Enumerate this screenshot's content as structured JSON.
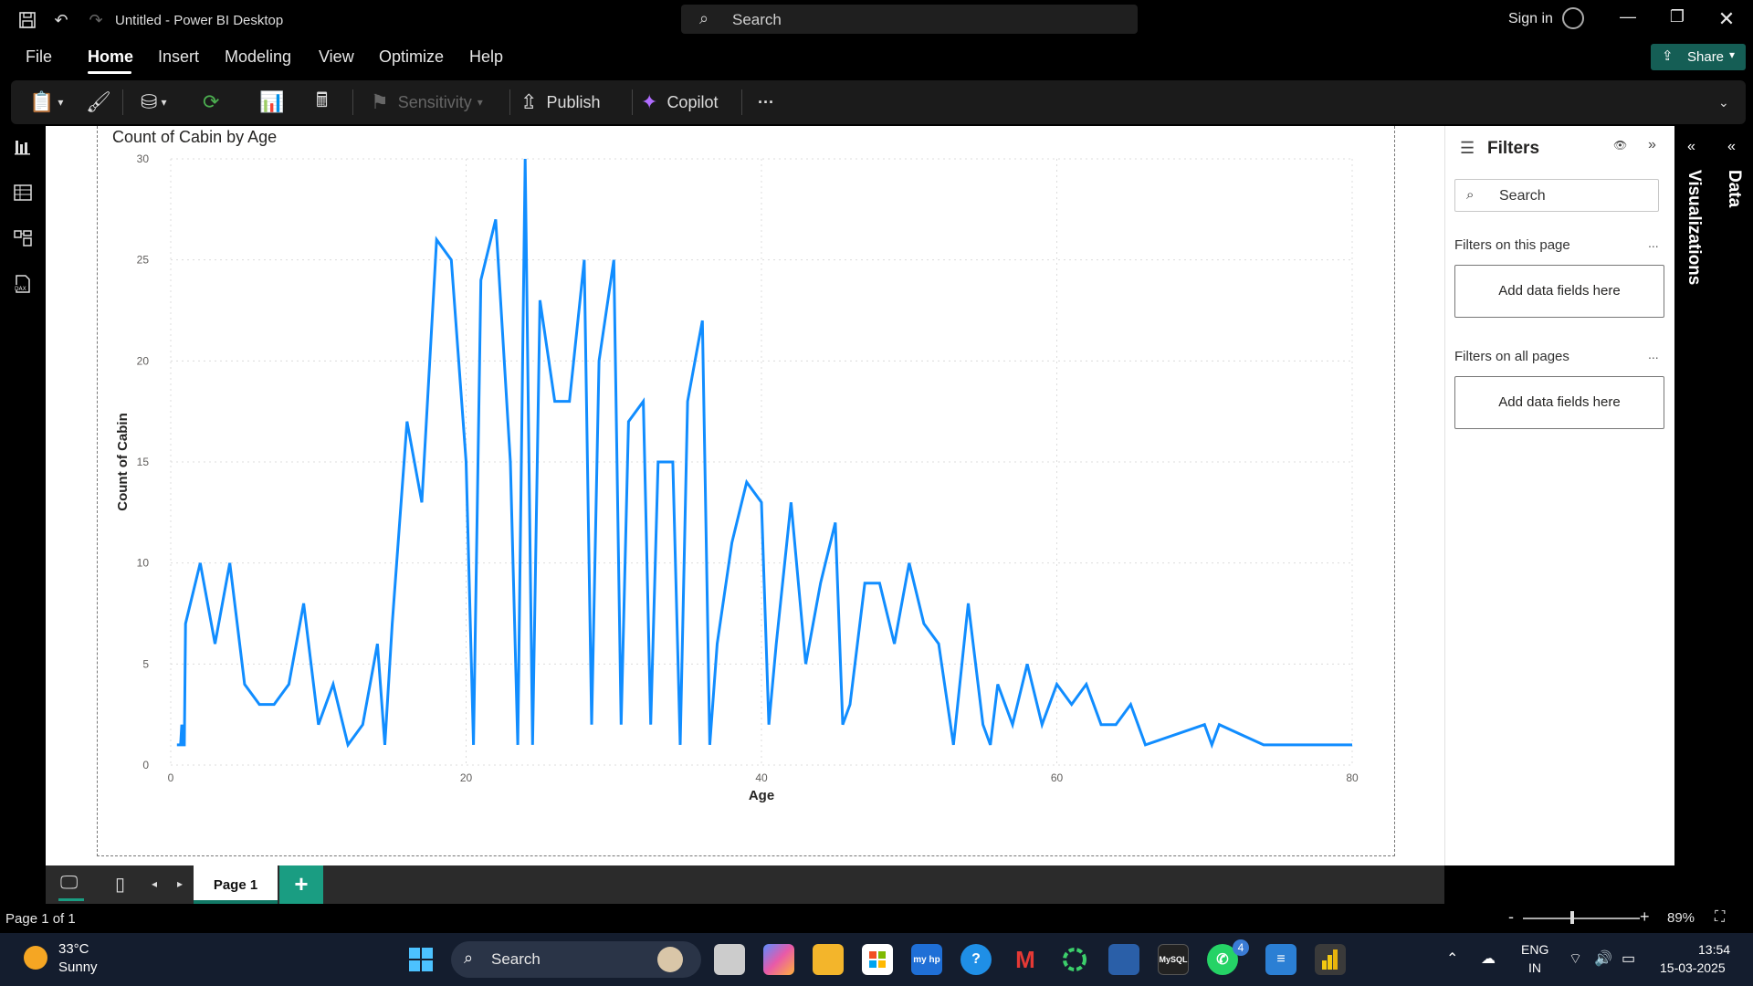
{
  "window": {
    "title": "Untitled - Power BI Desktop",
    "search_placeholder": "Search",
    "sign_in": "Sign in"
  },
  "menu": {
    "items": [
      "File",
      "Home",
      "Insert",
      "Modeling",
      "View",
      "Optimize",
      "Help"
    ],
    "active": "Home",
    "share_label": "Share"
  },
  "ribbon": {
    "sensitivity_label": "Sensitivity",
    "publish_label": "Publish",
    "copilot_label": "Copilot",
    "more_label": "···"
  },
  "chart_data": {
    "type": "line",
    "title": "Count of Cabin by Age",
    "xlabel": "Age",
    "ylabel": "Count of Cabin",
    "xlim": [
      0,
      80
    ],
    "ylim": [
      0,
      30
    ],
    "xticks": [
      0,
      20,
      40,
      60,
      80
    ],
    "yticks": [
      0,
      5,
      10,
      15,
      20,
      25,
      30
    ],
    "grid": true,
    "color": "#118DFF",
    "x": [
      0.42,
      0.67,
      0.75,
      0.83,
      0.92,
      1,
      2,
      3,
      4,
      5,
      6,
      7,
      8,
      9,
      10,
      11,
      12,
      13,
      14,
      14.5,
      15,
      16,
      17,
      18,
      19,
      20,
      20.5,
      21,
      22,
      23,
      23.5,
      24,
      24.5,
      25,
      26,
      27,
      28,
      28.5,
      29,
      30,
      30.5,
      31,
      32,
      32.5,
      33,
      34,
      34.5,
      35,
      36,
      36.5,
      37,
      38,
      39,
      40,
      40.5,
      41,
      42,
      43,
      44,
      45,
      45.5,
      46,
      47,
      48,
      49,
      50,
      51,
      52,
      53,
      54,
      55,
      55.5,
      56,
      57,
      58,
      59,
      60,
      61,
      62,
      63,
      64,
      65,
      66,
      70,
      70.5,
      71,
      74,
      80
    ],
    "y": [
      1,
      1,
      2,
      1,
      1,
      7,
      10,
      6,
      10,
      4,
      3,
      3,
      4,
      8,
      2,
      4,
      1,
      2,
      6,
      1,
      7,
      17,
      13,
      26,
      25,
      15,
      1,
      24,
      27,
      15,
      1,
      30,
      1,
      23,
      18,
      18,
      25,
      2,
      20,
      25,
      2,
      17,
      18,
      2,
      15,
      15,
      1,
      18,
      22,
      1,
      6,
      11,
      14,
      13,
      2,
      6,
      13,
      5,
      9,
      12,
      2,
      3,
      9,
      9,
      6,
      10,
      7,
      6,
      1,
      8,
      2,
      1,
      4,
      2,
      5,
      2,
      4,
      3,
      4,
      2,
      2,
      3,
      1,
      2,
      1,
      2,
      1,
      1
    ]
  },
  "filters": {
    "title": "Filters",
    "search_placeholder": "Search",
    "on_this_page": "Filters on this page",
    "on_all_pages": "Filters on all pages",
    "drop_label": "Add data fields here",
    "more": "..."
  },
  "rails": {
    "visualizations": "Visualizations",
    "data": "Data"
  },
  "pages": {
    "tab": "Page 1",
    "add": "+"
  },
  "status": {
    "page": "Page 1 of 1",
    "zoom": "89%"
  },
  "taskbar": {
    "temp": "33°C",
    "weather": "Sunny",
    "search": "Search",
    "lang": "ENG",
    "region": "IN",
    "time": "13:54",
    "date": "15-03-2025",
    "whatsapp_badge": "4"
  }
}
